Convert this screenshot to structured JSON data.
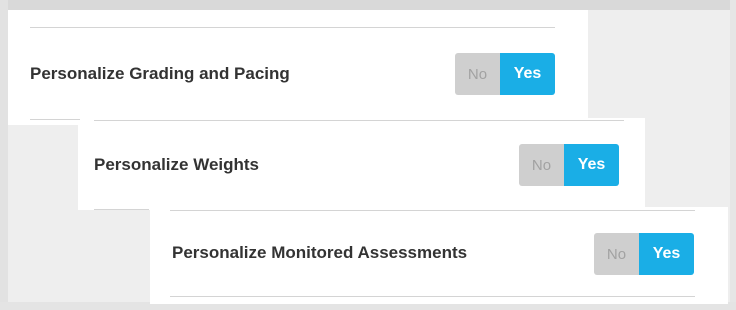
{
  "settings": [
    {
      "label": "Personalize Grading and Pacing",
      "no_label": "No",
      "yes_label": "Yes",
      "value": "Yes"
    },
    {
      "label": "Personalize Weights",
      "no_label": "No",
      "yes_label": "Yes",
      "value": "Yes"
    },
    {
      "label": "Personalize Monitored Assessments",
      "no_label": "No",
      "yes_label": "Yes",
      "value": "Yes"
    }
  ],
  "colors": {
    "active": "#1aaee6",
    "inactive": "#cfcfcf"
  }
}
